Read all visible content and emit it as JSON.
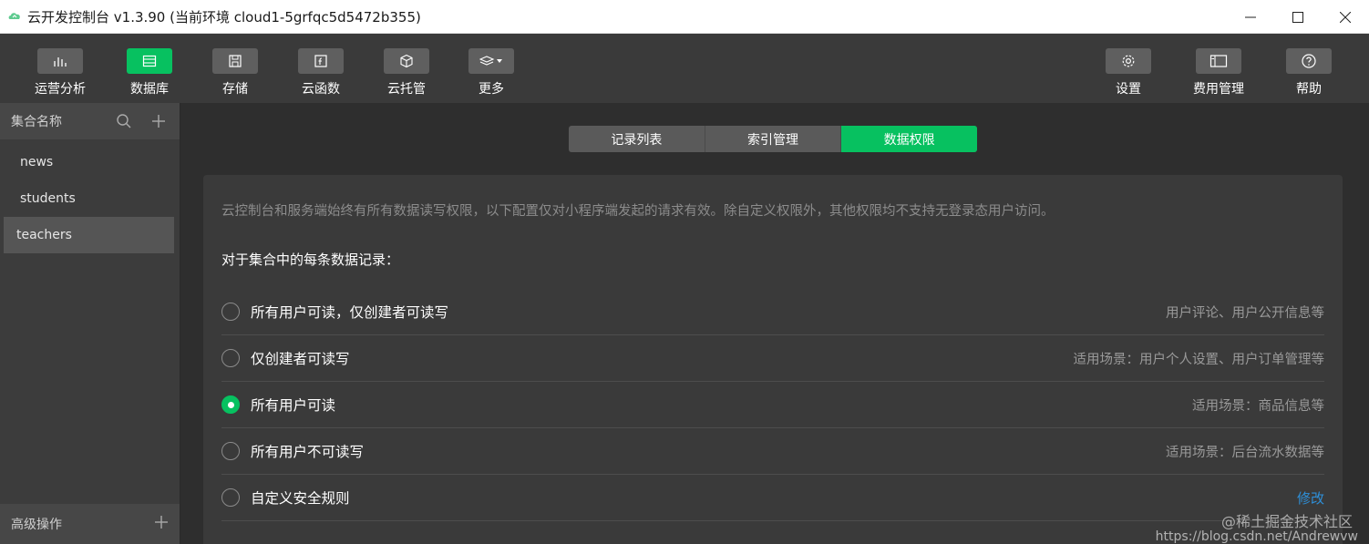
{
  "titlebar": {
    "title": "云开发控制台 v1.3.90  (当前环境 cloud1-5grfqc5d5472b355)",
    "app_icon": "cloud-leaf-icon",
    "controls": [
      "minimize-icon",
      "maximize-icon",
      "close-icon"
    ]
  },
  "toolbar": {
    "left_tools": [
      {
        "label": "运营分析",
        "icon": "bar-chart-icon",
        "active": false
      },
      {
        "label": "数据库",
        "icon": "database-icon",
        "active": true
      },
      {
        "label": "存储",
        "icon": "floppy-icon",
        "active": false
      },
      {
        "label": "云函数",
        "icon": "function-icon",
        "active": false
      },
      {
        "label": "云托管",
        "icon": "cube-icon",
        "active": false
      },
      {
        "label": "更多",
        "icon": "layers-icon",
        "active": false
      }
    ],
    "right_tools": [
      {
        "label": "设置",
        "icon": "gear-icon"
      },
      {
        "label": "费用管理",
        "icon": "billing-icon"
      },
      {
        "label": "帮助",
        "icon": "help-icon"
      }
    ]
  },
  "sidebar": {
    "header_label": "集合名称",
    "collections": [
      "news",
      "students",
      "teachers"
    ],
    "selected": "teachers",
    "footer_label": "高级操作"
  },
  "tabs": [
    "记录列表",
    "索引管理",
    "数据权限"
  ],
  "active_tab": "数据权限",
  "permissions": {
    "notice": "云控制台和服务端始终有所有数据读写权限，以下配置仅对小程序端发起的请求有效。除自定义权限外，其他权限均不支持无登录态用户访问。",
    "section_title": "对于集合中的每条数据记录：",
    "options": [
      {
        "label": "所有用户可读，仅创建者可读写",
        "desc": "用户评论、用户公开信息等",
        "checked": false
      },
      {
        "label": "仅创建者可读写",
        "desc": "适用场景：用户个人设置、用户订单管理等",
        "checked": false
      },
      {
        "label": "所有用户可读",
        "desc": "适用场景：商品信息等",
        "checked": true
      },
      {
        "label": "所有用户不可读写",
        "desc": "适用场景：后台流水数据等",
        "checked": false
      },
      {
        "label": "自定义安全规则",
        "desc": "修改",
        "checked": false
      }
    ]
  },
  "watermark": {
    "line1": "@稀土掘金技术社区",
    "line2": "https://blog.csdn.net/Andrewvw"
  },
  "colors": {
    "accent": "#07c160",
    "link": "#2e8fd8"
  }
}
